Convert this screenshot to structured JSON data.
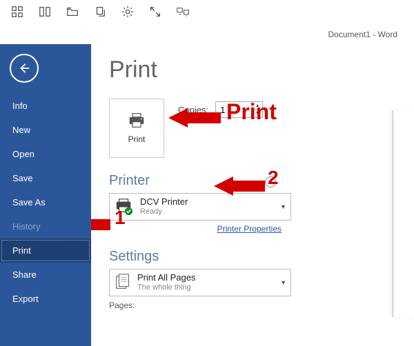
{
  "title_bar": "Document1 - Word",
  "sidebar": {
    "items": [
      {
        "label": "Info"
      },
      {
        "label": "New"
      },
      {
        "label": "Open"
      },
      {
        "label": "Save"
      },
      {
        "label": "Save As"
      },
      {
        "label": "History"
      },
      {
        "label": "Print"
      },
      {
        "label": "Share"
      },
      {
        "label": "Export"
      }
    ],
    "selected_index": 6,
    "disabled_index": 5
  },
  "page": {
    "title": "Print",
    "print_button_label": "Print",
    "copies_label": "Copies:",
    "copies_value": "1",
    "printer_heading": "Printer",
    "printer_name": "DCV Printer",
    "printer_status": "Ready",
    "printer_properties_link": "Printer Properties",
    "settings_heading": "Settings",
    "settings_option_title": "Print All Pages",
    "settings_option_sub": "The whole thing",
    "pages_label": "Pages:"
  },
  "annotations": {
    "print_label": "Print",
    "num1": "1",
    "num2": "2"
  }
}
